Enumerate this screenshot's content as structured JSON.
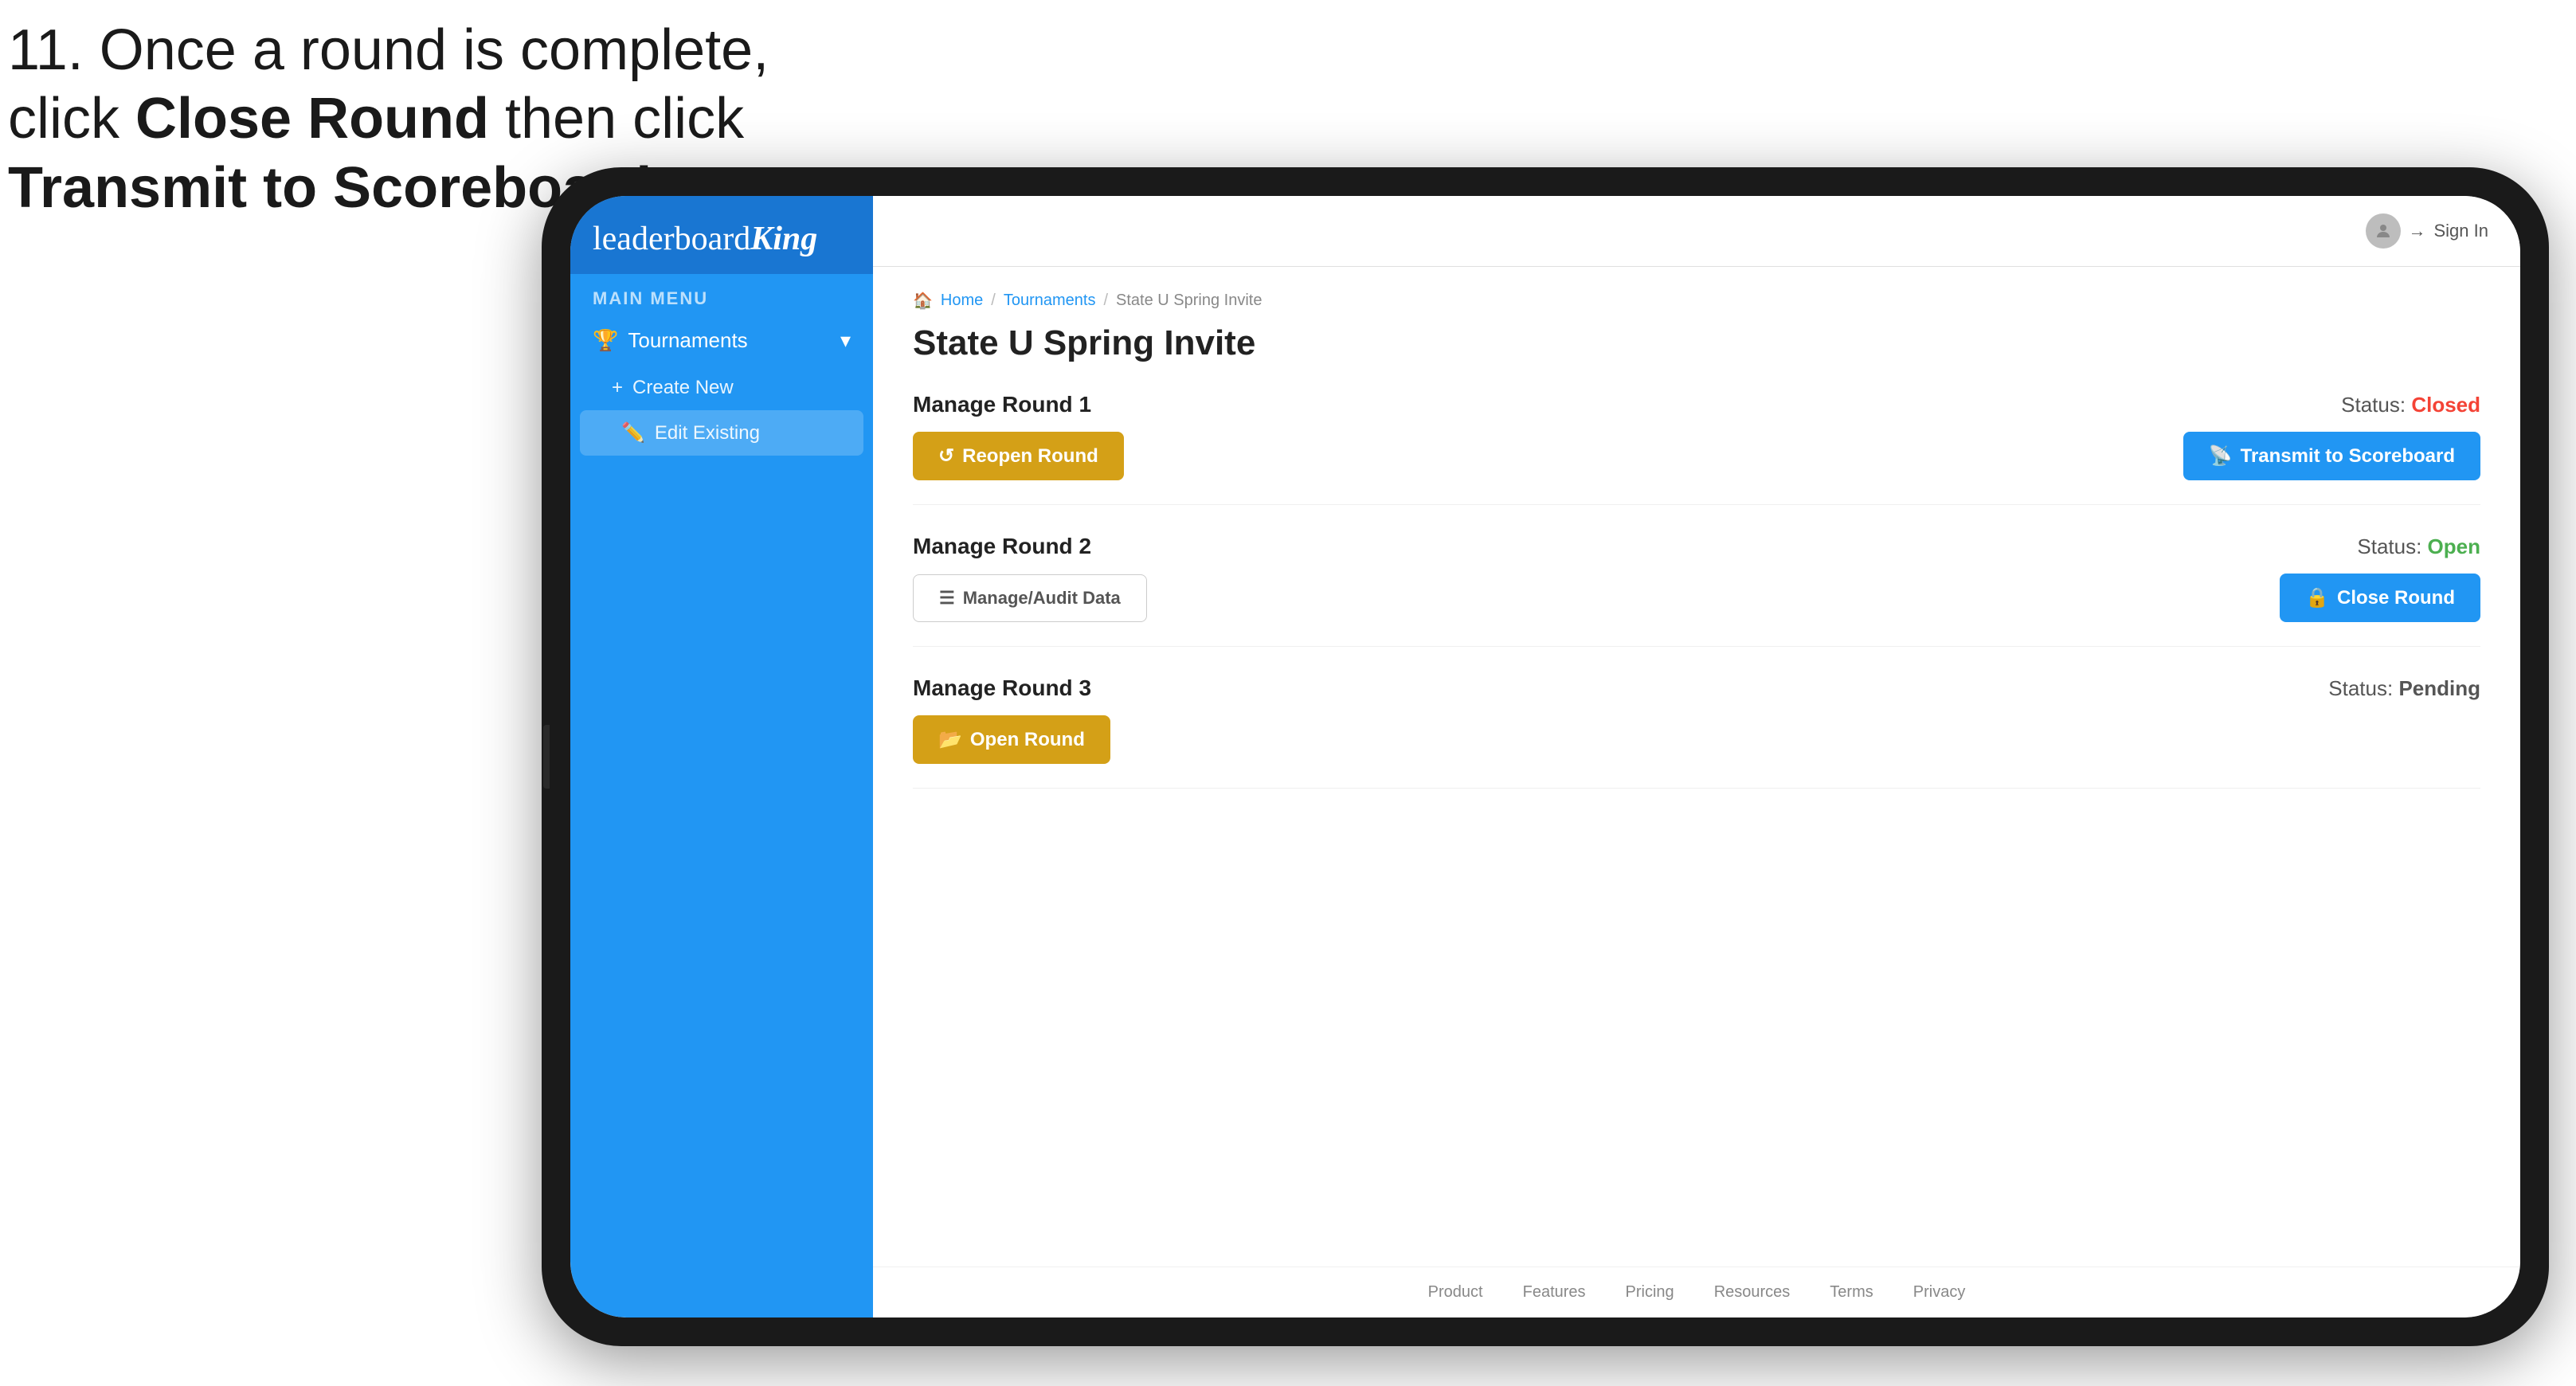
{
  "instruction": {
    "line1": "11. Once a round is complete,",
    "line2": "click ",
    "bold1": "Close Round",
    "line3": " then click",
    "bold2": "Transmit to Scoreboard."
  },
  "sidebar": {
    "logo": "leaderboard",
    "logo_king": "King",
    "menu_label": "MAIN MENU",
    "tournaments_label": "Tournaments",
    "create_new_label": "Create New",
    "edit_existing_label": "Edit Existing"
  },
  "topbar": {
    "sign_in_label": "Sign In"
  },
  "breadcrumb": {
    "home": "Home",
    "tournaments": "Tournaments",
    "current": "State U Spring Invite"
  },
  "page": {
    "title": "State U Spring Invite"
  },
  "rounds": [
    {
      "title": "Manage Round 1",
      "status_label": "Status:",
      "status_value": "Closed",
      "status_type": "closed",
      "left_btn_label": "Reopen Round",
      "right_btn_label": "Transmit to Scoreboard",
      "right_btn_type": "blue"
    },
    {
      "title": "Manage Round 2",
      "status_label": "Status:",
      "status_value": "Open",
      "status_type": "open",
      "left_btn_label": "Manage/Audit Data",
      "right_btn_label": "Close Round",
      "right_btn_type": "blue"
    },
    {
      "title": "Manage Round 3",
      "status_label": "Status:",
      "status_value": "Pending",
      "status_type": "pending",
      "left_btn_label": "Open Round",
      "right_btn_label": null,
      "right_btn_type": null
    }
  ],
  "footer": {
    "links": [
      "Product",
      "Features",
      "Pricing",
      "Resources",
      "Terms",
      "Privacy"
    ]
  }
}
